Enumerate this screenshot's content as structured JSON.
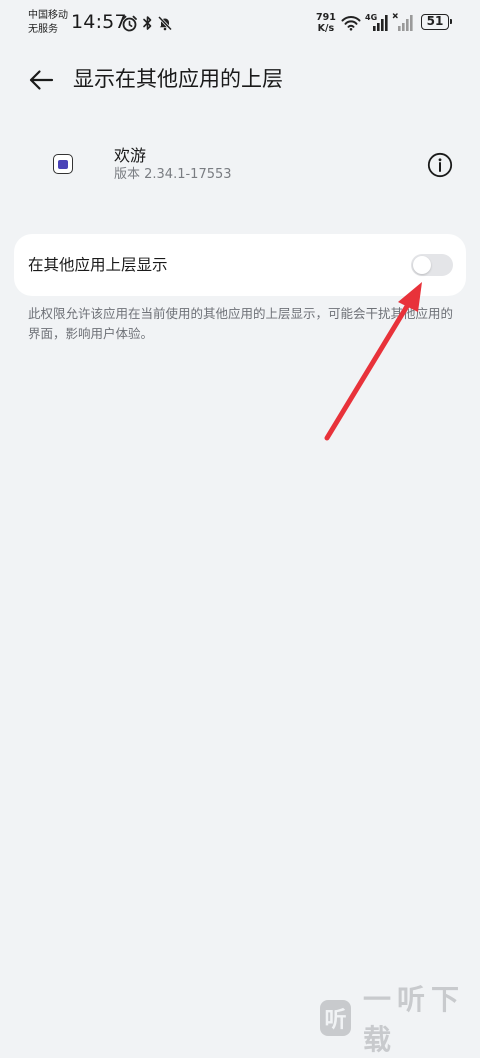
{
  "status_bar": {
    "carrier_line1": "中国移动",
    "carrier_line2": "无服务",
    "time": "14:57",
    "net_speed_value": "791",
    "net_speed_unit": "K/s",
    "signal_label": "4G",
    "battery": "51",
    "icons": [
      "alarm-icon",
      "bluetooth-icon",
      "mute-bell-icon",
      "wifi-icon",
      "signal-4g-icon",
      "signal-no-service-icon",
      "battery-icon"
    ]
  },
  "header": {
    "title": "显示在其他应用的上层",
    "back_icon": "arrow-left-icon"
  },
  "app": {
    "name": "欢游",
    "version": "版本 2.34.1-17553",
    "info_icon": "info-icon"
  },
  "setting": {
    "label": "在其他应用上层显示",
    "enabled": false,
    "description": "此权限允许该应用在当前使用的其他应用的上层显示，可能会干扰其他应用的界面，影响用户体验。"
  },
  "watermark": {
    "logo_text": "听",
    "text": "一听下载"
  },
  "colors": {
    "background": "#f1f3f5",
    "card": "#ffffff",
    "toggle_off": "#e4e5e8",
    "annotation_arrow": "#e8323a",
    "app_icon_accent": "#4a43b8"
  }
}
